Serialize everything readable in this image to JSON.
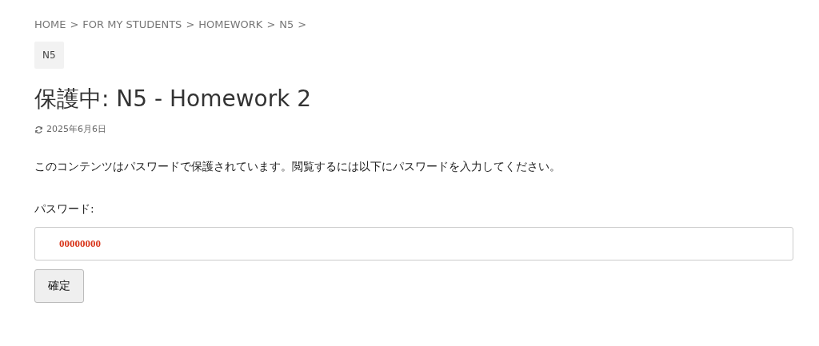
{
  "breadcrumb": [
    {
      "label": "HOME"
    },
    {
      "label": "FOR MY STUDENTS"
    },
    {
      "label": "HOMEWORK"
    },
    {
      "label": "N5"
    }
  ],
  "breadcrumb_separator": ">",
  "category_tag": "N5",
  "title": "保護中: N5 - Homework 2",
  "updated_date": "2025年6月6日",
  "notice": "このコンテンツはパスワードで保護されています。閲覧するには以下にパスワードを入力してください。",
  "password_field": {
    "label": "パスワード:",
    "value": "00000000"
  },
  "submit_button": "確定"
}
